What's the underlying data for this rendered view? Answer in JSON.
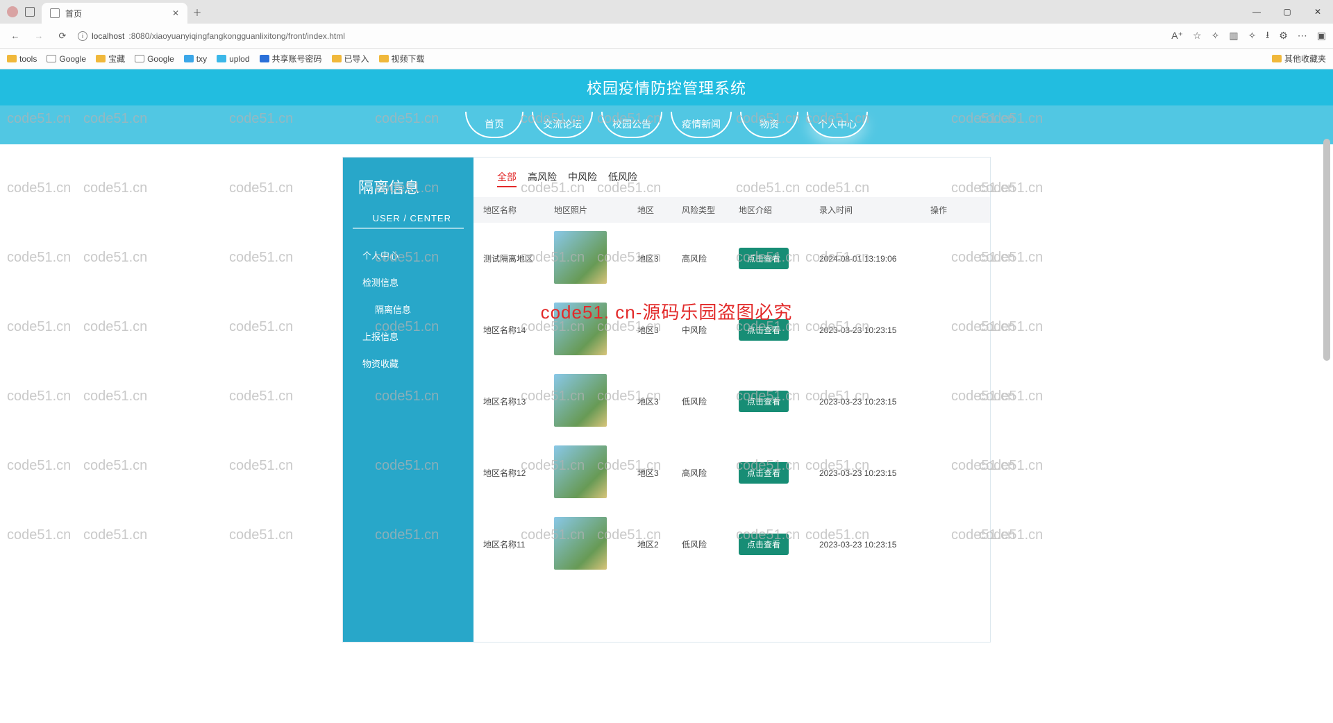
{
  "browser": {
    "tab_title": "首页",
    "url_prefix": "localhost",
    "url_rest": ":8080/xiaoyuanyiqingfangkongguanlixitong/front/index.html",
    "bookmarks": [
      "tools",
      "Google",
      "宝藏",
      "Google",
      "txy",
      "uplod",
      "共享账号密码",
      "已导入",
      "视频下载"
    ],
    "other_bookmarks": "其他收藏夹"
  },
  "header": {
    "title": "校园疫情防控管理系统"
  },
  "nav": {
    "items": [
      "首页",
      "交流论坛",
      "校园公告",
      "疫情新闻",
      "物资",
      "个人中心"
    ],
    "active_index": 5
  },
  "sidebar": {
    "title": "隔离信息",
    "subtitle": "USER  /  CENTER",
    "items": [
      {
        "label": "个人中心",
        "indent": false
      },
      {
        "label": "检测信息",
        "indent": false
      },
      {
        "label": "隔离信息",
        "indent": true
      },
      {
        "label": "上报信息",
        "indent": false
      },
      {
        "label": "物资收藏",
        "indent": false
      }
    ]
  },
  "filters": {
    "items": [
      "全部",
      "高风险",
      "中风险",
      "低风险"
    ],
    "active_index": 0
  },
  "table": {
    "columns": [
      "地区名称",
      "地区照片",
      "地区",
      "风险类型",
      "地区介绍",
      "录入时间",
      "操作"
    ],
    "view_label": "点击查看",
    "rows": [
      {
        "name": "测试隔离地区",
        "region": "地区3",
        "risk": "高风险",
        "time": "2024-08-01 13:19:06"
      },
      {
        "name": "地区名称14",
        "region": "地区3",
        "risk": "中风险",
        "time": "2023-03-23 10:23:15"
      },
      {
        "name": "地区名称13",
        "region": "地区3",
        "risk": "低风险",
        "time": "2023-03-23 10:23:15"
      },
      {
        "name": "地区名称12",
        "region": "地区3",
        "risk": "高风险",
        "time": "2023-03-23 10:23:15"
      },
      {
        "name": "地区名称11",
        "region": "地区2",
        "risk": "低风险",
        "time": "2023-03-23 10:23:15"
      }
    ]
  },
  "watermark": {
    "repeat_text": "code51.cn",
    "center_text": "code51. cn-源码乐园盗图必究"
  }
}
